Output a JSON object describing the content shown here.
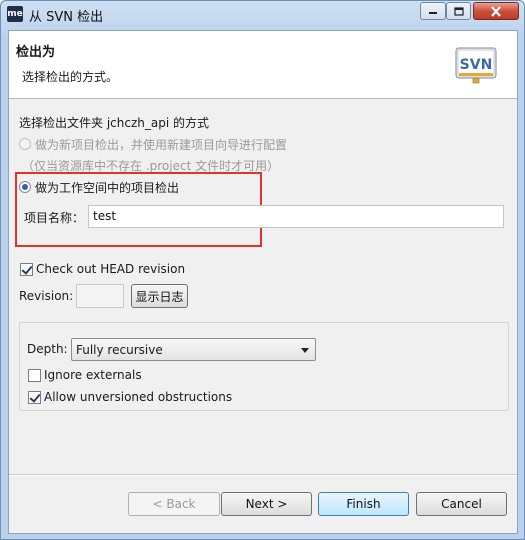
{
  "window": {
    "title": "从 SVN 检出",
    "app_icon": "me"
  },
  "header": {
    "title": "检出为",
    "description": "选择检出的方式。",
    "logo_text": "SVN"
  },
  "body": {
    "section_label": "选择检出文件夹 jchczh_api 的方式",
    "option_new_project": "做为新项目检出，并使用新建项目向导进行配置",
    "option_new_project_note": "（仅当资源库中不存在 .project 文件时才可用）",
    "option_workspace_project": "做为工作空间中的项目检出",
    "project_name_label": "项目名称：",
    "project_name_value": "test",
    "checkout_head_label": "Check out HEAD revision",
    "revision_label": "Revision:",
    "revision_value": "",
    "show_log_label": "显示日志"
  },
  "options": {
    "depth_label": "Depth:",
    "depth_value": "Fully recursive",
    "ignore_externals_label": "Ignore externals",
    "allow_unversioned_label": "Allow unversioned obstructions"
  },
  "buttons": {
    "back": "< Back",
    "next": "Next >",
    "finish": "Finish",
    "cancel": "Cancel"
  },
  "colors": {
    "highlight_box": "#e0322f",
    "title_bar": "#b9d1ec",
    "close_button": "#c9503d"
  },
  "icons": [
    "minimize-icon",
    "maximize-icon",
    "close-icon",
    "svn-logo"
  ]
}
